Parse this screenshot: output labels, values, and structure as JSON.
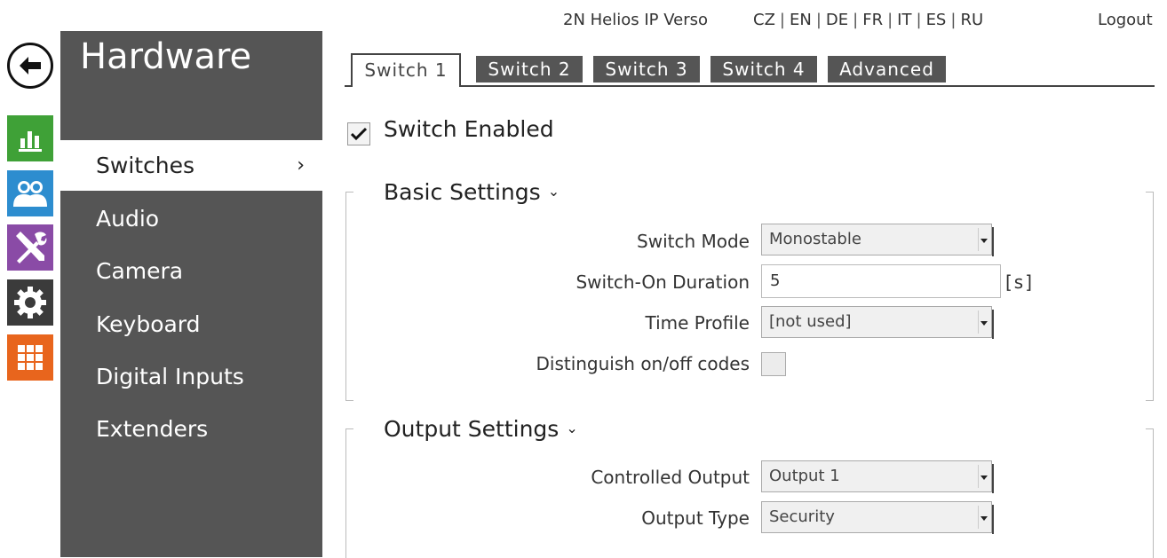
{
  "header": {
    "device_name": "2N Helios IP Verso",
    "languages": [
      "CZ",
      "EN",
      "DE",
      "FR",
      "IT",
      "ES",
      "RU"
    ],
    "logout_label": "Logout"
  },
  "rail": {
    "items": [
      {
        "icon": "bar-chart-icon",
        "color": "#3fa137"
      },
      {
        "icon": "users-icon",
        "color": "#2d8dcf"
      },
      {
        "icon": "tools-icon",
        "color": "#8a4ba6"
      },
      {
        "icon": "gear-icon",
        "color": "#3b3b3b"
      },
      {
        "icon": "grid-icon",
        "color": "#e8651d"
      }
    ]
  },
  "sidebar": {
    "title": "Hardware",
    "items": [
      {
        "label": "Switches",
        "active": true
      },
      {
        "label": "Audio"
      },
      {
        "label": "Camera"
      },
      {
        "label": "Keyboard"
      },
      {
        "label": "Digital Inputs"
      },
      {
        "label": "Extenders"
      }
    ],
    "active_arrow": "›"
  },
  "tabs": [
    {
      "label": "Switch 1",
      "active": true
    },
    {
      "label": "Switch 2"
    },
    {
      "label": "Switch 3"
    },
    {
      "label": "Switch 4"
    },
    {
      "label": "Advanced"
    }
  ],
  "switch_enabled": {
    "label": "Switch Enabled",
    "checked": true
  },
  "basic_settings": {
    "title": "Basic Settings",
    "switch_mode": {
      "label": "Switch Mode",
      "value": "Monostable"
    },
    "switch_on_duration": {
      "label": "Switch-On Duration",
      "value": "5",
      "unit": "[s]"
    },
    "time_profile": {
      "label": "Time Profile",
      "value": "[not used]"
    },
    "distinguish_codes": {
      "label": "Distinguish on/off codes",
      "checked": false
    }
  },
  "output_settings": {
    "title": "Output Settings",
    "controlled_output": {
      "label": "Controlled Output",
      "value": "Output 1"
    },
    "output_type": {
      "label": "Output Type",
      "value": "Security"
    }
  }
}
